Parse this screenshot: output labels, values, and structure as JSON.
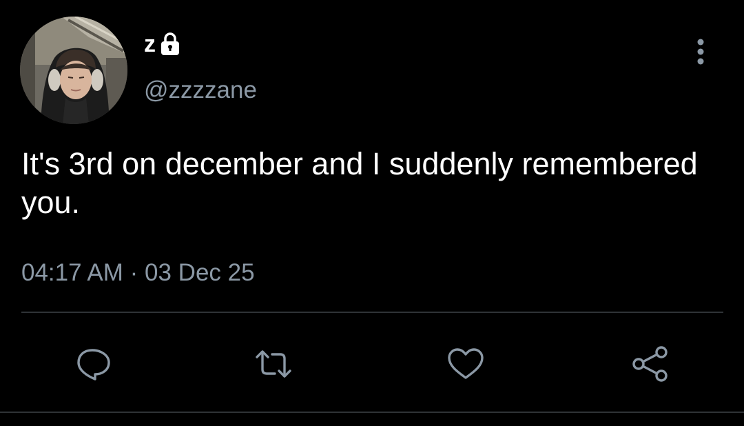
{
  "tweet": {
    "display_name": "z",
    "handle": "@zzzzane",
    "text": "It's 3rd on december and I suddenly remembered you.",
    "time": "04:17 AM",
    "separator": "·",
    "date": "03 Dec 25",
    "account_locked": true
  },
  "icons": {
    "lock": "lock-icon",
    "more": "more-vertical-icon",
    "reply": "reply-icon",
    "retweet": "retweet-icon",
    "like": "heart-icon",
    "share": "share-icon"
  },
  "colors": {
    "background": "#000000",
    "text": "#ffffff",
    "secondary_text": "#8b98a5",
    "divider": "#2f3336",
    "icon": "#8b98a5"
  }
}
